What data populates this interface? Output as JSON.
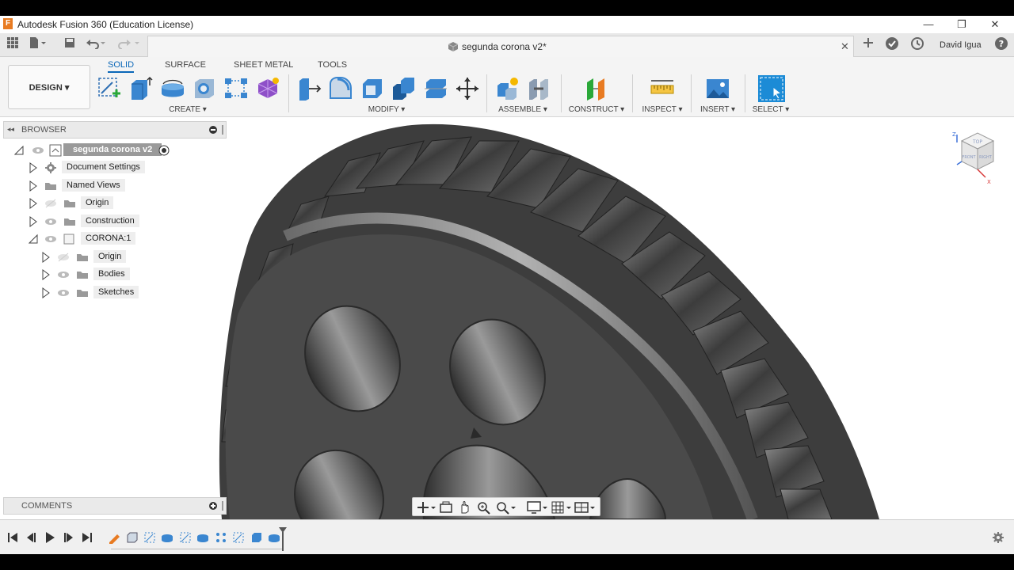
{
  "app": {
    "title": "Autodesk Fusion 360 (Education License)",
    "icon_letter": "F",
    "window_controls": [
      "—",
      "❐",
      "✕"
    ]
  },
  "document": {
    "tab_title": "segunda corona v2*",
    "close_symbol": "✕"
  },
  "user": {
    "name": "David Igua"
  },
  "ribbon": {
    "workspace": "DESIGN ▾",
    "tabs": [
      {
        "label": "SOLID"
      },
      {
        "label": "SURFACE"
      },
      {
        "label": "SHEET METAL"
      },
      {
        "label": "TOOLS"
      }
    ],
    "groups": [
      {
        "label": "CREATE ▾"
      },
      {
        "label": "MODIFY ▾"
      },
      {
        "label": "ASSEMBLE ▾"
      },
      {
        "label": "CONSTRUCT ▾"
      },
      {
        "label": "INSPECT ▾"
      },
      {
        "label": "INSERT ▾"
      },
      {
        "label": "SELECT ▾"
      }
    ]
  },
  "browser": {
    "header": "BROWSER",
    "root": "segunda corona v2",
    "items": [
      {
        "label": "Document Settings"
      },
      {
        "label": "Named Views"
      },
      {
        "label": "Origin"
      },
      {
        "label": "Construction"
      },
      {
        "label": "CORONA:1"
      },
      {
        "label": "Origin"
      },
      {
        "label": "Bodies"
      },
      {
        "label": "Sketches"
      }
    ]
  },
  "comments": {
    "header": "COMMENTS"
  },
  "viewcube": {
    "top": "TOP",
    "front": "FRONT",
    "right": "RIGHT",
    "axis_x": "X",
    "axis_z": "Z"
  },
  "colors": {
    "accent": "#0a67b8",
    "select_blue": "#1c8bd6",
    "gear": "#4a4a4a"
  }
}
